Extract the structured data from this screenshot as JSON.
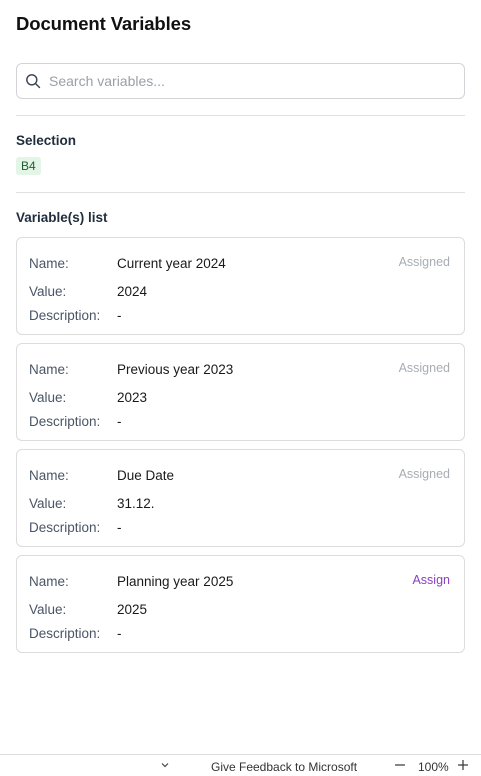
{
  "header": {
    "title": "Document Variables"
  },
  "search": {
    "placeholder": "Search variables..."
  },
  "selection": {
    "label": "Selection",
    "cell": "B4"
  },
  "variables": {
    "label": "Variable(s) list",
    "name_label": "Name:",
    "value_label": "Value:",
    "description_label": "Description:",
    "items": [
      {
        "name": "Current year 2024",
        "value": "2024",
        "description": "-",
        "status": "Assigned"
      },
      {
        "name": "Previous year 2023",
        "value": "2023",
        "description": "-",
        "status": "Assigned"
      },
      {
        "name": "Due Date",
        "value": "31.12.",
        "description": "-",
        "status": "Assigned"
      },
      {
        "name": "Planning year 2025",
        "value": "2025",
        "description": "-",
        "status": "Assign"
      }
    ]
  },
  "statusbar": {
    "feedback": "Give Feedback to Microsoft",
    "zoom": "100%"
  },
  "icons": {
    "search": "search-icon",
    "chevron": "chevron-down-icon",
    "zoom_out": "minus-icon",
    "zoom_in": "plus-icon"
  },
  "colors": {
    "assign_link": "#8a3fc4",
    "assigned_text": "#a8adb5",
    "badge_bg": "#e3f5e6"
  }
}
